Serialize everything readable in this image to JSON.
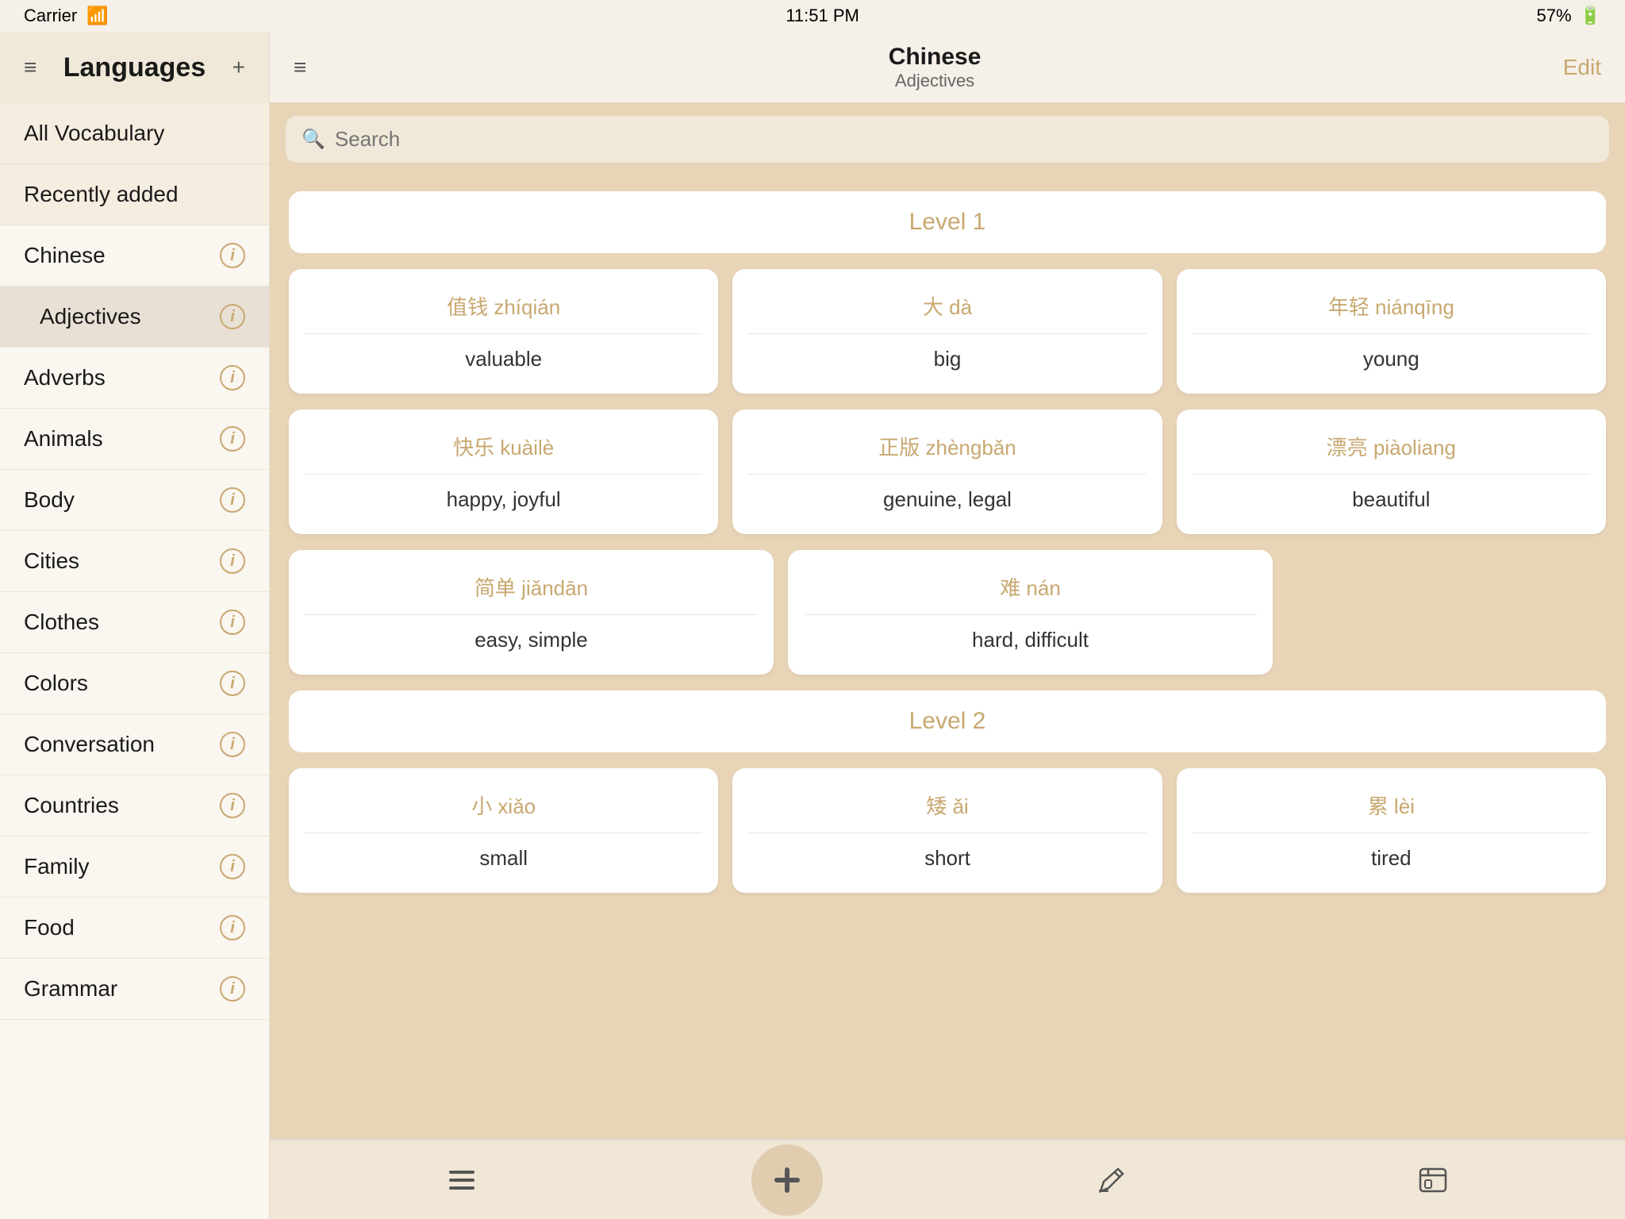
{
  "statusBar": {
    "carrier": "Carrier",
    "time": "11:51 PM",
    "battery": "57%"
  },
  "sidebar": {
    "title": "Languages",
    "specialItems": [
      {
        "label": "All Vocabulary"
      },
      {
        "label": "Recently added"
      }
    ],
    "languageHeader": "Chinese",
    "items": [
      {
        "label": "Adjectives",
        "active": true
      },
      {
        "label": "Adverbs",
        "active": false
      },
      {
        "label": "Animals",
        "active": false
      },
      {
        "label": "Body",
        "active": false
      },
      {
        "label": "Cities",
        "active": false
      },
      {
        "label": "Clothes",
        "active": false
      },
      {
        "label": "Colors",
        "active": false
      },
      {
        "label": "Conversation",
        "active": false
      },
      {
        "label": "Countries",
        "active": false
      },
      {
        "label": "Family",
        "active": false
      },
      {
        "label": "Food",
        "active": false
      },
      {
        "label": "Grammar",
        "active": false
      }
    ]
  },
  "mainPanel": {
    "title": "Chinese",
    "subtitle": "Adjectives",
    "editLabel": "Edit",
    "search": {
      "placeholder": "Search"
    },
    "levels": [
      {
        "label": "Level 1",
        "cards": [
          {
            "chinese": "值钱 zhíqián",
            "english": "valuable"
          },
          {
            "chinese": "大 dà",
            "english": "big"
          },
          {
            "chinese": "年轻 niánqīng",
            "english": "young"
          },
          {
            "chinese": "快乐 kuàilè",
            "english": "happy, joyful"
          },
          {
            "chinese": "正版 zhèngbǎn",
            "english": "genuine, legal"
          },
          {
            "chinese": "漂亮 piàoliang",
            "english": "beautiful"
          },
          {
            "chinese": "简单 jiǎndān",
            "english": "easy, simple"
          },
          {
            "chinese": "难 nán",
            "english": "hard, difficult"
          }
        ]
      },
      {
        "label": "Level 2",
        "cards": [
          {
            "chinese": "小 xiǎo",
            "english": "small"
          },
          {
            "chinese": "矮 ǎi",
            "english": "short"
          },
          {
            "chinese": "累 lèi",
            "english": "tired"
          }
        ]
      }
    ]
  },
  "toolbar": {
    "listIcon": "☰",
    "addIcon": "+",
    "editIcon": "✎",
    "settingsIcon": "⊟"
  }
}
